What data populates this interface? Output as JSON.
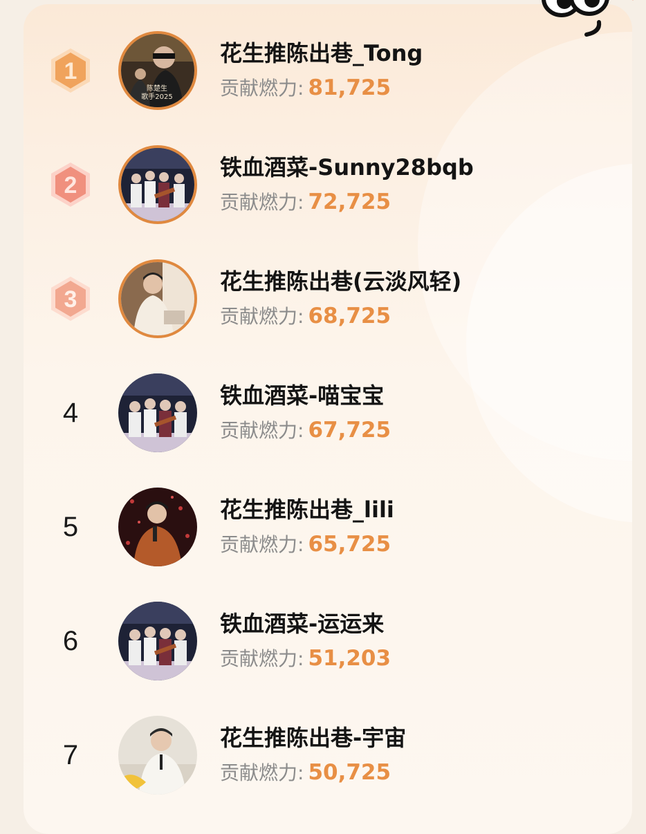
{
  "leaderboard": {
    "contribution_label": "贡献燃力:",
    "entries": [
      {
        "rank": "1",
        "name": "花生推陈出巷_Tong",
        "value": "81,725",
        "avatar_caption": "陈楚生\n歌手2025"
      },
      {
        "rank": "2",
        "name": "铁血酒菜-Sunny28bqb",
        "value": "72,725"
      },
      {
        "rank": "3",
        "name": "花生推陈出巷(云淡风轻)",
        "value": "68,725"
      },
      {
        "rank": "4",
        "name": "铁血酒菜-喵宝宝",
        "value": "67,725"
      },
      {
        "rank": "5",
        "name": "花生推陈出巷_lili",
        "value": "65,725"
      },
      {
        "rank": "6",
        "name": "铁血酒菜-运运来",
        "value": "51,203"
      },
      {
        "rank": "7",
        "name": "花生推陈出巷-宇宙",
        "value": "50,725"
      }
    ]
  },
  "colors": {
    "accent": "#e88f45",
    "badge_gold": "#f0a35c",
    "badge_silver": "#f0907e",
    "badge_bronze": "#f2a890"
  }
}
